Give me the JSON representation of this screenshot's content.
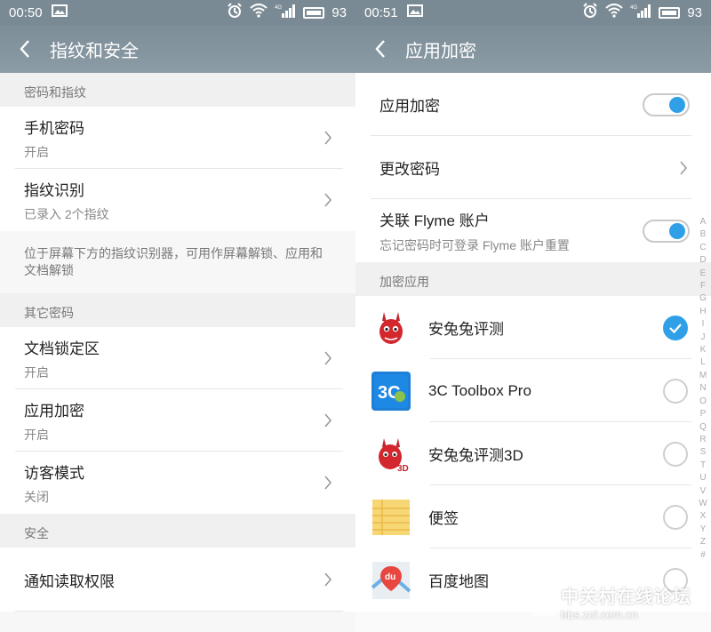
{
  "left": {
    "status": {
      "time": "00:50",
      "battery": "93",
      "net": "4G"
    },
    "title": "指纹和安全",
    "sections": [
      {
        "header": "密码和指纹"
      },
      {
        "header": "其它密码"
      },
      {
        "header": "安全"
      }
    ],
    "rows": {
      "phone_password": {
        "label": "手机密码",
        "sub": "开启"
      },
      "fingerprint": {
        "label": "指纹识别",
        "sub": "已录入 2个指纹"
      },
      "doc_lock": {
        "label": "文档锁定区",
        "sub": "开启"
      },
      "app_encrypt": {
        "label": "应用加密",
        "sub": "开启"
      },
      "guest_mode": {
        "label": "访客模式",
        "sub": "关闭"
      },
      "notif_perm": {
        "label": "通知读取权限"
      }
    },
    "note": "位于屏幕下方的指纹识别器，可用作屏幕解锁、应用和文档解锁"
  },
  "right": {
    "status": {
      "time": "00:51",
      "battery": "93",
      "net": "4G"
    },
    "title": "应用加密",
    "app_encrypt_label": "应用加密",
    "change_password_label": "更改密码",
    "flyme_label": "关联 Flyme 账户",
    "flyme_sub": "忘记密码时可登录 Flyme 账户重置",
    "section_header": "加密应用",
    "apps": [
      {
        "name": "安兔兔评测",
        "checked": true
      },
      {
        "name": "3C Toolbox Pro",
        "checked": false
      },
      {
        "name": "安兔兔评测3D",
        "checked": false
      },
      {
        "name": "便签",
        "checked": false
      },
      {
        "name": "百度地图",
        "checked": false
      }
    ],
    "index_letters": [
      "A",
      "B",
      "C",
      "D",
      "E",
      "F",
      "G",
      "H",
      "I",
      "J",
      "K",
      "L",
      "M",
      "N",
      "O",
      "P",
      "Q",
      "R",
      "S",
      "T",
      "U",
      "V",
      "W",
      "X",
      "Y",
      "Z",
      "#"
    ],
    "accent_color": "#2fa0e8"
  },
  "watermark": {
    "main": "中关村在线论坛",
    "sub": "bbs.zol.com.cn"
  },
  "icons": {
    "app1_badge": "du",
    "app2_label": "3C",
    "app3_badge": "3D"
  }
}
